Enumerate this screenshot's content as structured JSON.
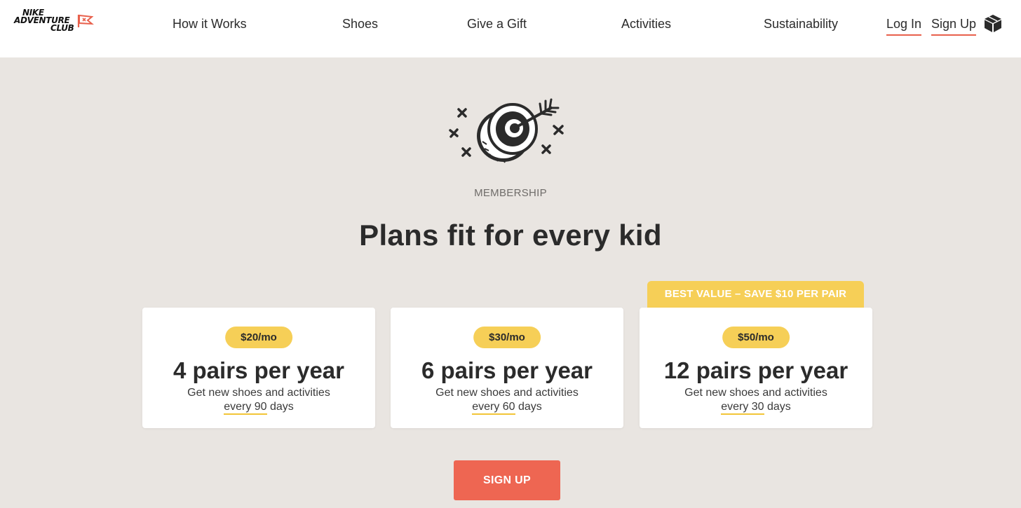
{
  "header": {
    "logo": {
      "line1": "NIKE",
      "line2": "ADVENTURE",
      "line3": "CLUB",
      "flag_color": "#e8604c"
    },
    "nav": [
      "How it Works",
      "Shoes",
      "Give a Gift",
      "Activities",
      "Sustainability"
    ],
    "login_label": "Log In",
    "signup_label": "Sign Up",
    "cart_icon": "box-icon"
  },
  "hero": {
    "icon": "target-arrow-icon",
    "eyebrow": "MEMBERSHIP",
    "title": "Plans fit for every kid"
  },
  "best_value_label": "BEST VALUE – SAVE $10 PER PAIR",
  "plans": [
    {
      "price": "$20/mo",
      "title": "4 pairs per year",
      "desc": "Get new shoes and activities",
      "freq": "every 90",
      "days": " days"
    },
    {
      "price": "$30/mo",
      "title": "6 pairs per year",
      "desc": "Get new shoes and activities",
      "freq": "every 60",
      "days": " days"
    },
    {
      "price": "$50/mo",
      "title": "12 pairs per year",
      "desc": "Get new shoes and activities",
      "freq": "every 30",
      "days": " days"
    }
  ],
  "cta_label": "SIGN UP",
  "colors": {
    "accent": "#ee6652",
    "badge": "#f6cf57",
    "background": "#e9e5e1"
  }
}
